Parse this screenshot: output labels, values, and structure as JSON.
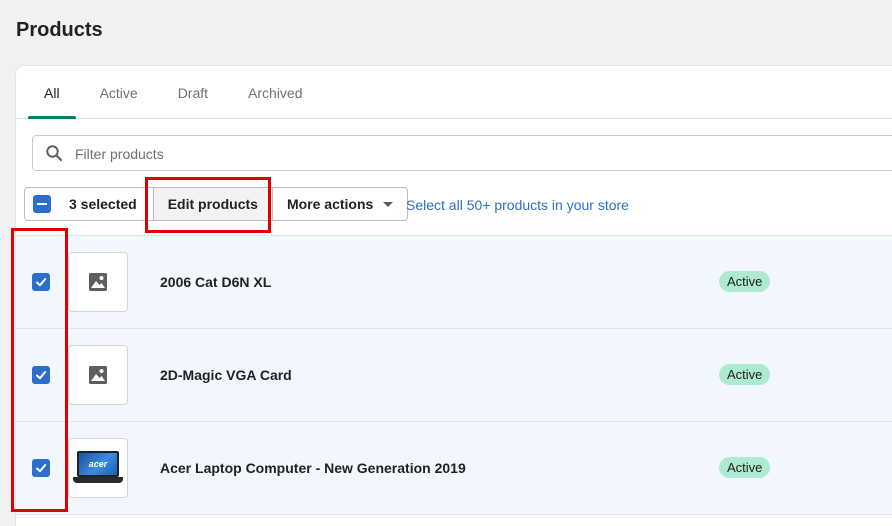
{
  "page": {
    "title": "Products"
  },
  "tabs": [
    {
      "label": "All",
      "active": true
    },
    {
      "label": "Active",
      "active": false
    },
    {
      "label": "Draft",
      "active": false
    },
    {
      "label": "Archived",
      "active": false
    }
  ],
  "filter": {
    "placeholder": "Filter products",
    "value": ""
  },
  "bulk_actions": {
    "selected_label": "3 selected",
    "edit_label": "Edit products",
    "more_label": "More actions",
    "select_all_label": "Select all 50+ products in your store"
  },
  "products": [
    {
      "name": "2006 Cat D6N XL",
      "status": "Active",
      "checked": true,
      "thumbnail": "image-placeholder-icon"
    },
    {
      "name": "2D-Magic VGA Card",
      "status": "Active",
      "checked": true,
      "thumbnail": "image-placeholder-icon"
    },
    {
      "name": "Acer Laptop Computer - New Generation 2019",
      "status": "Active",
      "checked": true,
      "thumbnail": "laptop-photo",
      "thumbnail_text": "acer"
    }
  ],
  "colors": {
    "accent": "#2c6ecb",
    "tab_indicator": "#008060",
    "badge_active": "#aee9d1",
    "highlight": "#e00000",
    "selected_row": "#f2f7fe"
  }
}
